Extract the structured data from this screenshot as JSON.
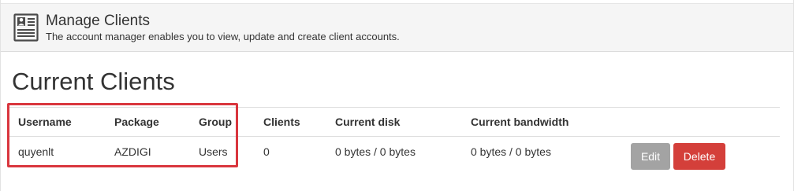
{
  "header": {
    "title": "Manage Clients",
    "description": "The account manager enables you to view, update and create client accounts.",
    "icon": "client-card-icon"
  },
  "section": {
    "title": "Current Clients"
  },
  "table": {
    "columns": [
      "Username",
      "Package",
      "Group",
      "Clients",
      "Current disk",
      "Current bandwidth"
    ],
    "rows": [
      {
        "username": "quyenlt",
        "package": "AZDIGI",
        "group": "Users",
        "clients": "0",
        "current_disk": "0 bytes / 0 bytes",
        "current_bandwidth": "0 bytes / 0 bytes",
        "actions": {
          "edit_label": "Edit",
          "delete_label": "Delete"
        }
      }
    ]
  },
  "colors": {
    "header_bg": "#f5f5f5",
    "edit_button": "#a3a3a3",
    "delete_button": "#d43f3a",
    "highlight_border": "#d9363e"
  }
}
